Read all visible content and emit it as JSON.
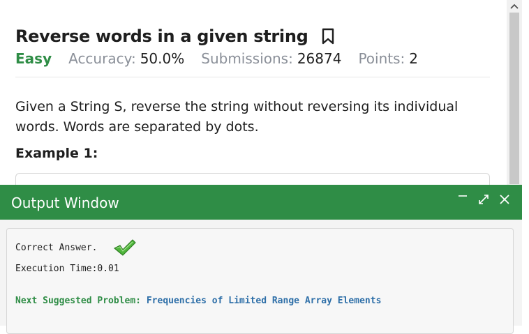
{
  "problem": {
    "title": "Reverse words in a given string",
    "difficulty": "Easy",
    "accuracy_label": "Accuracy:",
    "accuracy_value": "50.0%",
    "submissions_label": "Submissions:",
    "submissions_value": "26874",
    "points_label": "Points:",
    "points_value": "2",
    "statement": "Given a String S, reverse the string without reversing its individual words. Words are separated by dots.",
    "example_heading": "Example 1:"
  },
  "output_window": {
    "title": "Output Window",
    "result": "Correct Answer.",
    "execution_time": "Execution Time:0.01",
    "next_label": "Next Suggested Problem:",
    "next_problem": "Frequencies of Limited Range Array Elements"
  },
  "colors": {
    "brand_green": "#2f8d46",
    "link_blue": "#2e6fa8",
    "muted_gray": "#8a8f98"
  },
  "icons": {
    "bookmark": "bookmark-icon",
    "minimize": "minimize-icon",
    "expand": "expand-icon",
    "close": "close-icon",
    "check": "check-icon",
    "scroll_up": "chevron-up-icon"
  }
}
